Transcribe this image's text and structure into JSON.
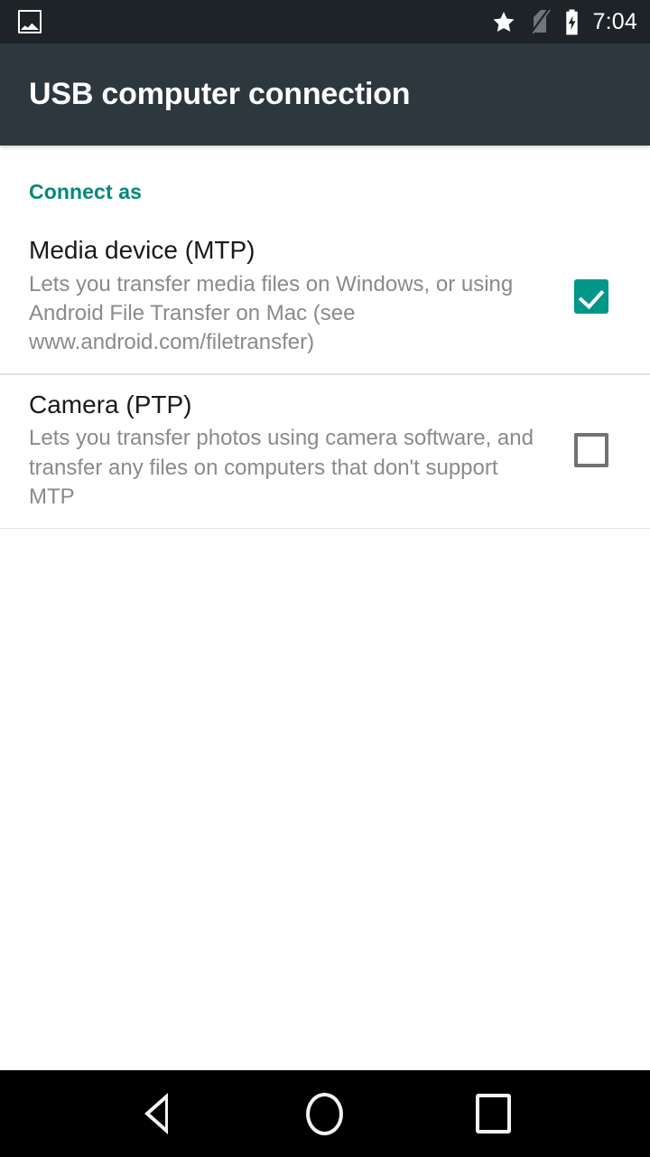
{
  "status_bar": {
    "notification_icon": "photo-icon",
    "icons": [
      "star-icon",
      "no-sim-icon",
      "battery-charging-icon"
    ],
    "time": "7:04",
    "background_color": "#1d2326"
  },
  "action_bar": {
    "title": "USB computer connection",
    "background_color": "#2d383e",
    "text_color": "#ffffff"
  },
  "content": {
    "section_header": "Connect as",
    "accent_color": "#00897b",
    "checkbox_checked_color": "#009688",
    "preferences": [
      {
        "title": "Media device (MTP)",
        "summary": "Lets you transfer media files on Windows, or using Android File Transfer on Mac (see www.android.com/filetransfer)",
        "checked": true,
        "checkbox_state": "checked"
      },
      {
        "title": "Camera (PTP)",
        "summary": "Lets you transfer photos using camera software, and transfer any files on computers that don't support MTP",
        "checked": false,
        "checkbox_state": "unchecked"
      }
    ]
  },
  "nav_bar": {
    "background_color": "#000000",
    "buttons": [
      {
        "name": "back",
        "icon": "back-triangle-icon"
      },
      {
        "name": "home",
        "icon": "home-circle-icon"
      },
      {
        "name": "recents",
        "icon": "recents-square-icon"
      }
    ]
  }
}
